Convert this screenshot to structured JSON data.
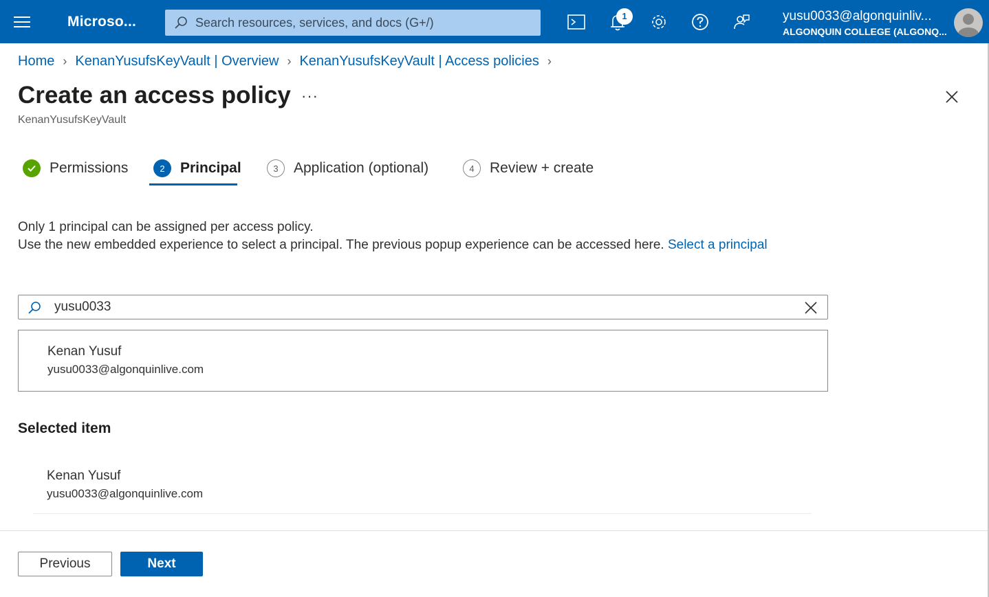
{
  "topbar": {
    "brand": "Microso...",
    "search_placeholder": "Search resources, services, and docs (G+/)",
    "notification_count": "1",
    "user_email": "yusu0033@algonquinliv...",
    "user_org": "ALGONQUIN COLLEGE (ALGONQ...",
    "icons": [
      "menu-icon",
      "cloud-shell-icon",
      "notifications-icon",
      "settings-icon",
      "help-icon",
      "feedback-icon"
    ]
  },
  "breadcrumb": {
    "items": [
      "Home",
      "KenanYusufsKeyVault | Overview",
      "KenanYusufsKeyVault | Access policies"
    ]
  },
  "page": {
    "title": "Create an access policy",
    "more": "···",
    "subtitle": "KenanYusufsKeyVault"
  },
  "steps": [
    {
      "number": "",
      "label": "Permissions",
      "state": "done"
    },
    {
      "number": "2",
      "label": "Principal",
      "state": "active"
    },
    {
      "number": "3",
      "label": "Application (optional)",
      "state": "todo"
    },
    {
      "number": "4",
      "label": "Review + create",
      "state": "todo"
    }
  ],
  "info": {
    "line1": "Only 1 principal can be assigned per access policy.",
    "line2": "Use the new embedded experience to select a principal. The previous popup experience can be accessed here.",
    "link": "Select a principal"
  },
  "search": {
    "value": "yusu0033"
  },
  "results": [
    {
      "name": "Kenan Yusuf",
      "email": "yusu0033@algonquinlive.com"
    }
  ],
  "selected": {
    "heading": "Selected item",
    "name": "Kenan Yusuf",
    "email": "yusu0033@algonquinlive.com"
  },
  "footer": {
    "previous_label": "Previous",
    "next_label": "Next"
  },
  "colors": {
    "accent": "#0063b1",
    "success": "#57a300",
    "text": "#323130"
  }
}
